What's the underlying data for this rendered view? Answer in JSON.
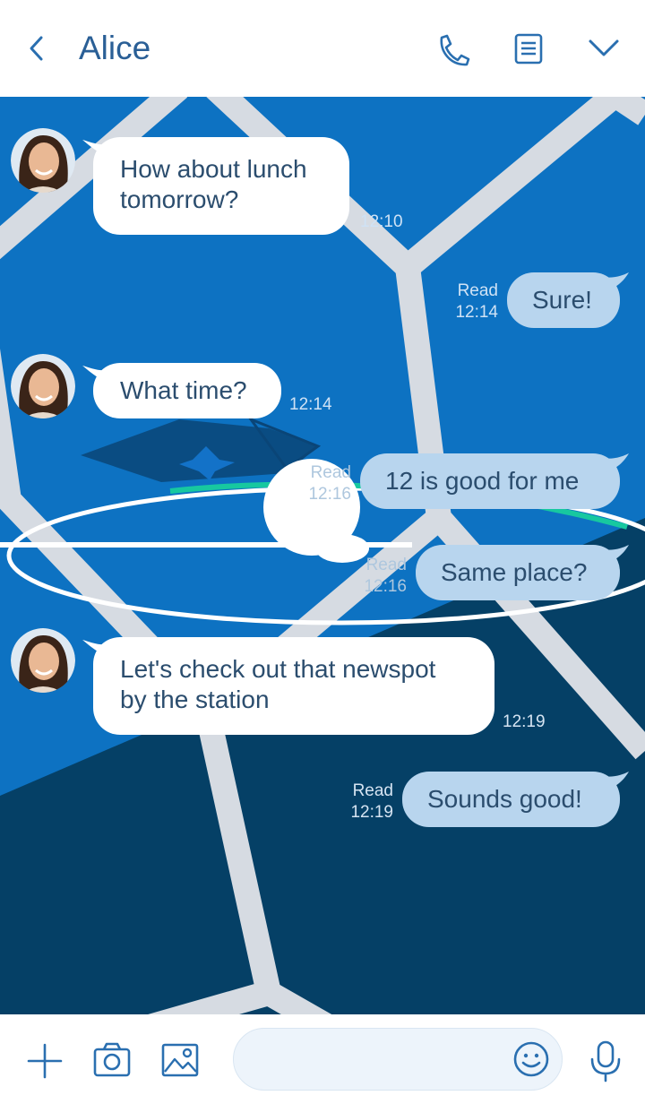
{
  "header": {
    "title": "Alice",
    "icons": {
      "back": "back-arrow-icon",
      "call": "phone-icon",
      "notes": "notes-icon",
      "menu": "chevron-down-icon"
    }
  },
  "colors": {
    "accent": "#2a6fb0",
    "chat_bg": "#0d72c2",
    "chat_bg_dark": "#054066",
    "incoming_bubble": "#ffffff",
    "outgoing_bubble": "#b8d5ee",
    "bubble_text": "#2b4d6e"
  },
  "messages": [
    {
      "direction": "in",
      "lines": [
        "How about lunch",
        "tomorrow?"
      ],
      "time": "12:10"
    },
    {
      "direction": "out",
      "text": "Sure!",
      "read": "Read",
      "time": "12:14"
    },
    {
      "direction": "in",
      "lines": [
        "What time?"
      ],
      "time": "12:14"
    },
    {
      "direction": "out",
      "text": "12 is good for me",
      "read": "Read",
      "time": "12:16"
    },
    {
      "direction": "out",
      "text": "Same place?",
      "read": "Read",
      "time": "12:16"
    },
    {
      "direction": "in",
      "lines": [
        "Let's check out that newspot",
        "by the station"
      ],
      "time": "12:19"
    },
    {
      "direction": "out",
      "text": "Sounds good!",
      "read": "Read",
      "time": "12:19"
    }
  ],
  "footer": {
    "icons": {
      "add": "plus-icon",
      "camera": "camera-icon",
      "gallery": "image-icon",
      "emoji": "smiley-icon",
      "voice": "microphone-icon"
    },
    "input_value": ""
  }
}
